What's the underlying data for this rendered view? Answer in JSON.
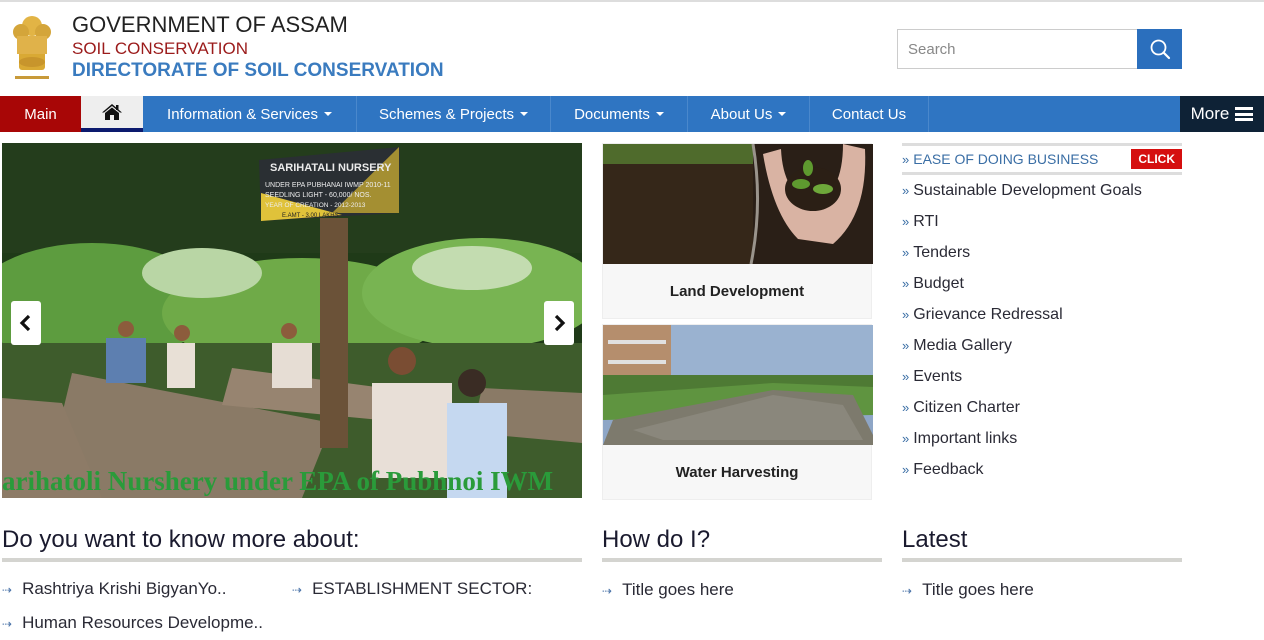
{
  "header": {
    "emblem": "state-emblem",
    "title1": "GOVERNMENT OF ASSAM",
    "title2": "SOIL CONSERVATION",
    "title3": "DIRECTORATE OF SOIL CONSERVATION",
    "search": {
      "placeholder": "Search",
      "value": "",
      "icon": "search-icon"
    }
  },
  "nav": {
    "main": "Main",
    "home_icon": "home-icon",
    "items": [
      {
        "label": "Information & Services",
        "dropdown": true
      },
      {
        "label": "Schemes & Projects",
        "dropdown": true
      },
      {
        "label": "Documents",
        "dropdown": true
      },
      {
        "label": "About Us",
        "dropdown": true
      },
      {
        "label": "Contact Us",
        "dropdown": false
      }
    ],
    "more": "More"
  },
  "slider": {
    "sign_lines": [
      "SARIHATALI NURSERY",
      "UNDER EPA PUBHANAI IWMP 2010-11",
      "SEEDLING LIGHT - 60,000/ NOS.",
      "YEAR OF CREATION - 2012-2013",
      "E.AMT - 3.00 LAKHS"
    ],
    "caption": "arihatoli Nurshery under EPA of Pubhnoi IWM"
  },
  "tiles": [
    {
      "label": "Land Development"
    },
    {
      "label": "Water Harvesting"
    }
  ],
  "right_list": {
    "highlight": {
      "label": "EASE OF DOING BUSINESS",
      "badge": "CLICK"
    },
    "items": [
      "Sustainable Development Goals",
      "RTI",
      "Tenders",
      "Budget",
      "Grievance Redressal",
      "Media Gallery",
      "Events",
      "Citizen Charter",
      "Important links",
      "Feedback"
    ]
  },
  "sections": {
    "know_more": {
      "title": "Do you want to know more about:",
      "links": [
        "Rashtriya Krishi BigyanYo..",
        "ESTABLISHMENT SECTOR:",
        "Human Resources Developme.."
      ]
    },
    "how_do_i": {
      "title": "How do I?",
      "links": [
        "Title goes here"
      ]
    },
    "latest": {
      "title": "Latest",
      "links": [
        "Title goes here"
      ]
    }
  },
  "colors": {
    "nav_blue": "#2f75c2",
    "main_red": "#a80606",
    "more_dark": "#0e2236",
    "title_blue": "#3a7bbf",
    "title_red": "#9b1b1b",
    "click_red": "#d50f0f"
  }
}
